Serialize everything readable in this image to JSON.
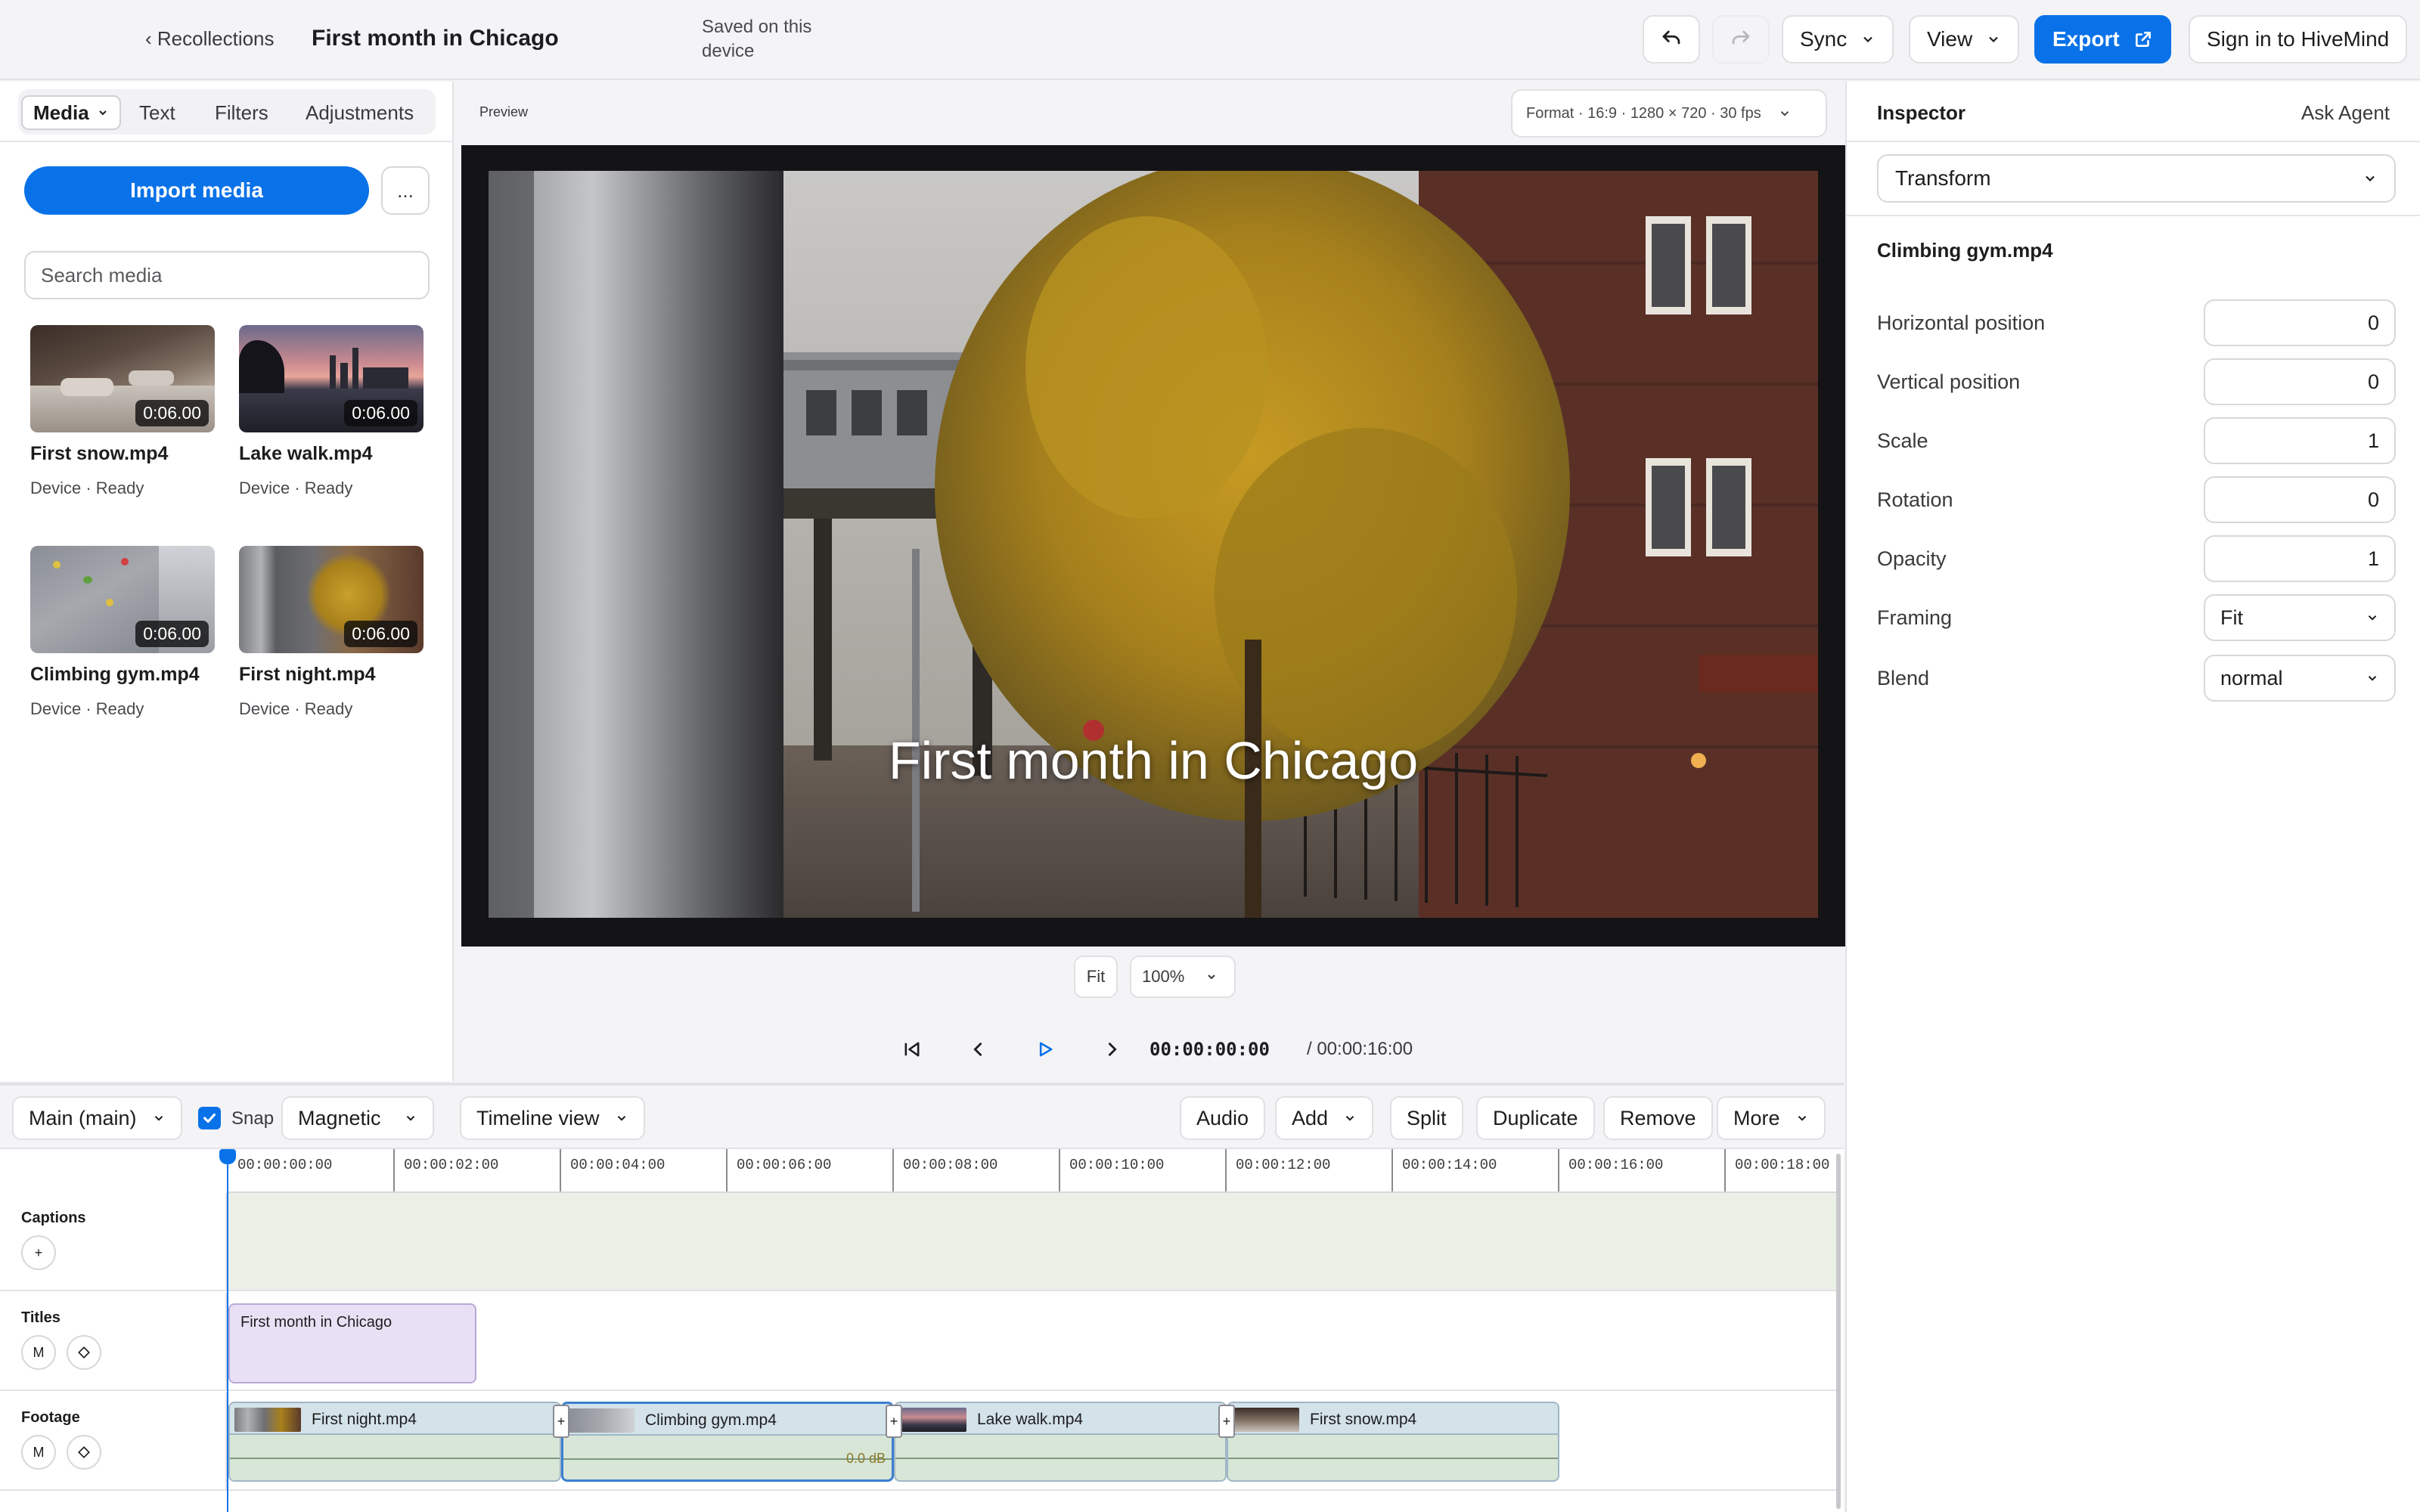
{
  "topbar": {
    "back_label": "Recollections",
    "project_title": "First month in Chicago",
    "save_status": "Saved on this device",
    "sync_label": "Sync",
    "view_label": "View",
    "export_label": "Export",
    "sign_in_label": "Sign in to HiveMind"
  },
  "left": {
    "tabs": [
      "Media",
      "Text",
      "Filters",
      "Adjustments"
    ],
    "import_label": "Import media",
    "more_label": "...",
    "search_placeholder": "Search media",
    "media": [
      {
        "name": "First snow.mp4",
        "duration": "0:06.00",
        "meta": "Device · Ready"
      },
      {
        "name": "Lake walk.mp4",
        "duration": "0:06.00",
        "meta": "Device · Ready"
      },
      {
        "name": "Climbing gym.mp4",
        "duration": "0:06.00",
        "meta": "Device · Ready"
      },
      {
        "name": "First night.mp4",
        "duration": "0:06.00",
        "meta": "Device · Ready"
      }
    ]
  },
  "preview": {
    "label": "Preview",
    "format": "Format · 16:9 · 1280 × 720 · 30 fps",
    "title_overlay": "First month in Chicago",
    "fit_label": "Fit",
    "zoom": "100%",
    "timecode": "00:00:00:00",
    "duration": "/ 00:00:16:00"
  },
  "inspector": {
    "title": "Inspector",
    "ask_agent": "Ask Agent",
    "section": "Transform",
    "clip_name": "Climbing gym.mp4",
    "props": [
      {
        "label": "Horizontal position",
        "value": "0"
      },
      {
        "label": "Vertical position",
        "value": "0"
      },
      {
        "label": "Scale",
        "value": "1"
      },
      {
        "label": "Rotation",
        "value": "0"
      },
      {
        "label": "Opacity",
        "value": "1"
      }
    ],
    "framing_label": "Framing",
    "framing_value": "Fit",
    "blend_label": "Blend",
    "blend_value": "normal"
  },
  "timeline": {
    "sequence": "Main (main)",
    "snap_label": "Snap",
    "snap_mode": "Magnetic",
    "view_mode": "Timeline view",
    "audio_label": "Audio",
    "add_label": "Add",
    "split_label": "Split",
    "duplicate_label": "Duplicate",
    "remove_label": "Remove",
    "more_label": "More",
    "ruler": [
      "00:00:00:00",
      "00:00:02:00",
      "00:00:04:00",
      "00:00:06:00",
      "00:00:08:00",
      "00:00:10:00",
      "00:00:12:00",
      "00:00:14:00",
      "00:00:16:00",
      "00:00:18:00"
    ],
    "tracks": {
      "captions": "Captions",
      "titles": "Titles",
      "footage": "Footage",
      "mute_label": "M",
      "add_label": "+"
    },
    "title_clip": "First month in Chicago",
    "footage_clips": [
      {
        "name": "First night.mp4"
      },
      {
        "name": "Climbing gym.mp4",
        "gain": "0.0 dB"
      },
      {
        "name": "Lake walk.mp4"
      },
      {
        "name": "First snow.mp4"
      }
    ]
  }
}
